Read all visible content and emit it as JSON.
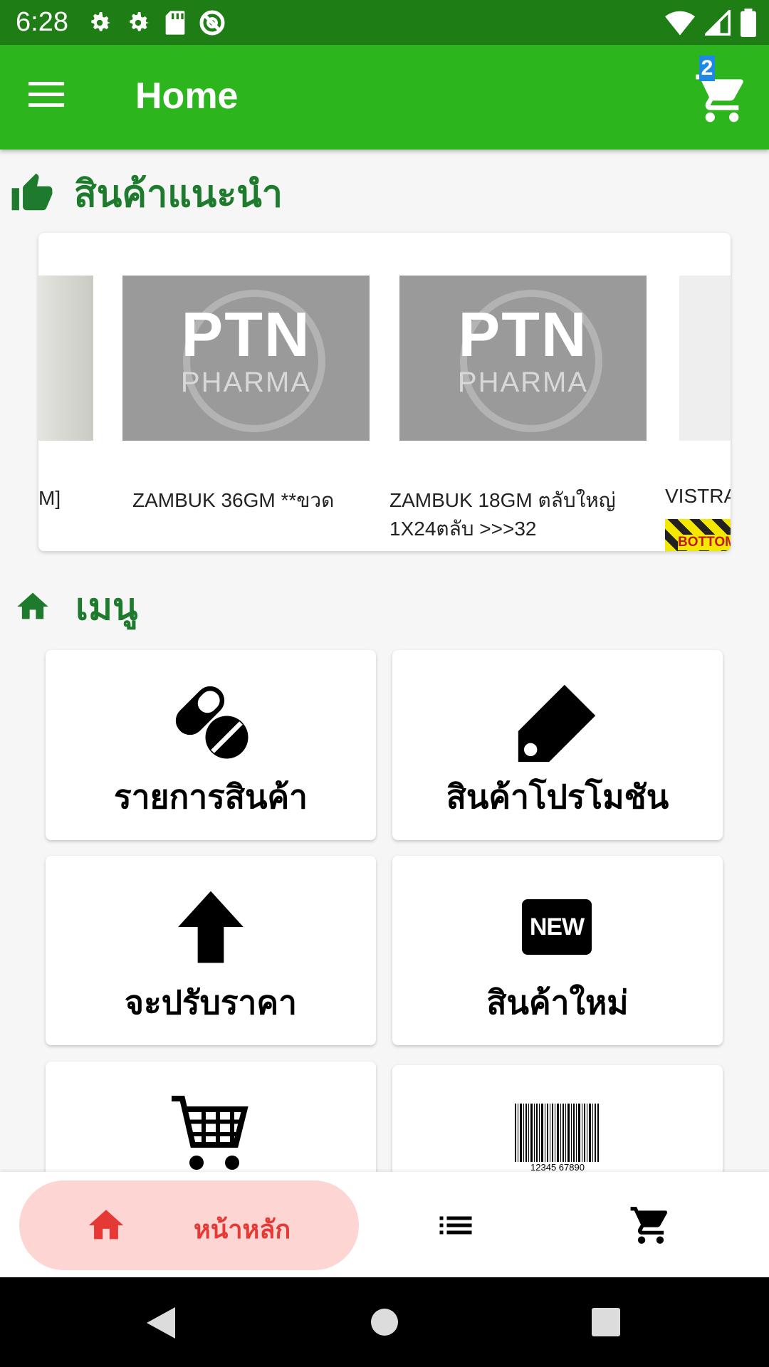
{
  "status_bar": {
    "time": "6:28"
  },
  "app_bar": {
    "title": "Home",
    "cart_count": "2"
  },
  "recommended": {
    "title": "สินค้าแนะนำ",
    "items": [
      {
        "name": "M]"
      },
      {
        "name": "ZAMBUK 36GM **ขวด",
        "image_line1": "PTN",
        "image_line2": "PHARMA"
      },
      {
        "name": "ZAMBUK 18GM ตลับใหญ่ 1X24ตลับ >>>32",
        "image_line1": "PTN",
        "image_line2": "PHARMA"
      },
      {
        "name": "VISTRA",
        "badge": "BOTTOM"
      }
    ]
  },
  "menu": {
    "title": "เมนู",
    "items": [
      {
        "label": "รายการสินค้า",
        "icon": "pill-icon"
      },
      {
        "label": "สินค้าโปรโมชัน",
        "icon": "tag-icon"
      },
      {
        "label": "จะปรับราคา",
        "icon": "arrow-up-icon"
      },
      {
        "label": "สินค้าใหม่",
        "icon": "new-badge-icon",
        "icon_text": "NEW"
      },
      {
        "label": "",
        "icon": "cart-icon"
      },
      {
        "label": "",
        "icon": "barcode-icon",
        "barcode_text": "12345 67890"
      }
    ]
  },
  "bottom_nav": {
    "home_label": "หน้าหลัก",
    "active_color": "#e53935"
  },
  "colors": {
    "primary": "#2db51e",
    "status_bar": "#1f7d16",
    "section_title": "#1e7a2c"
  }
}
